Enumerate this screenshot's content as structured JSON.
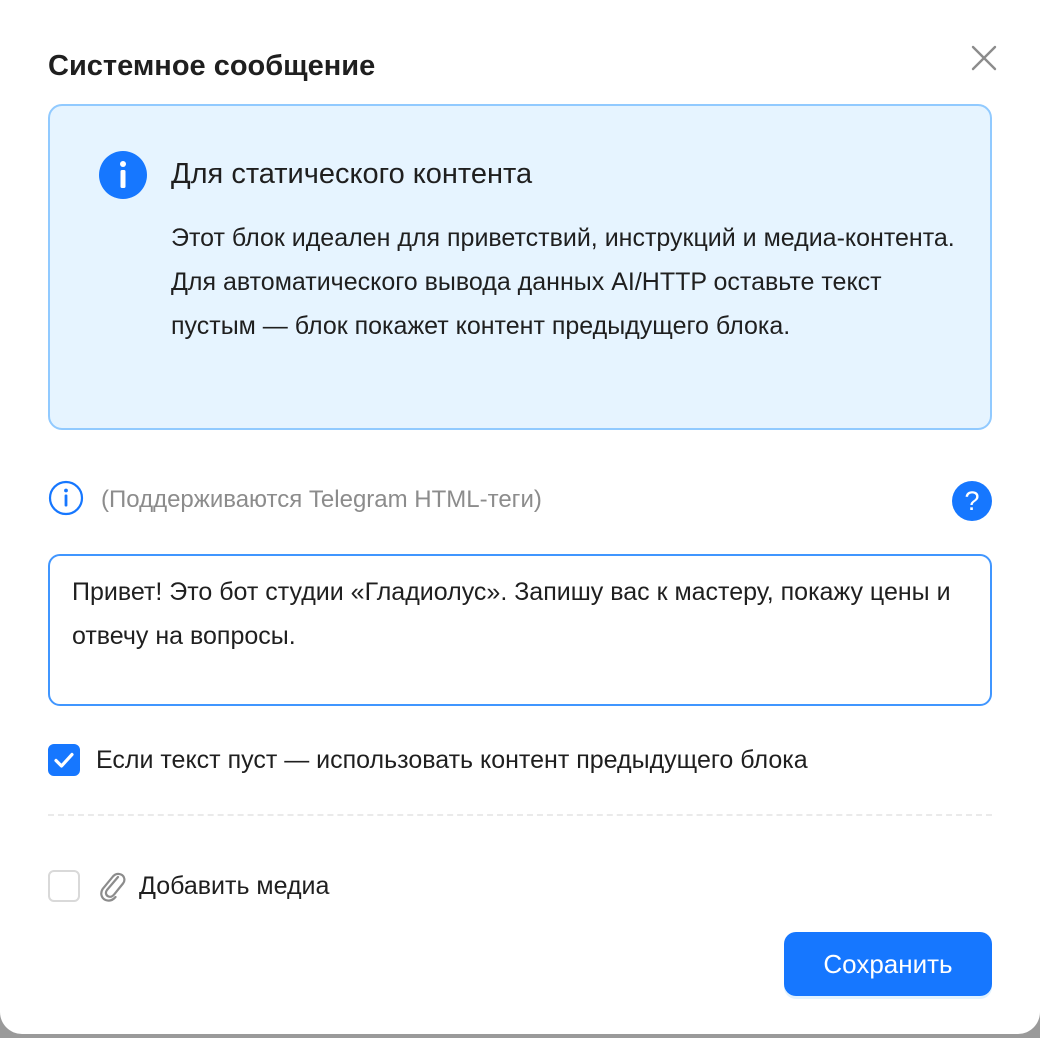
{
  "dialog": {
    "title": "Системное сообщение"
  },
  "info_box": {
    "title": "Для статического контента",
    "description": "Этот блок идеален для приветствий, инструкций и медиа-контента. Для автоматического вывода данных AI/HTTP оставьте текст пустым — блок покажет контент предыдущего блока.",
    "icon": "info-circle-filled-icon",
    "background_color": "#e6f4ff",
    "border_color": "#91caff"
  },
  "hint": {
    "text": "(Поддерживаются Telegram HTML-теги)",
    "icon": "info-circle-outline-icon",
    "help_label": "?"
  },
  "message": {
    "value": "Привет! Это бот студии «Гладиолус». Запишу вас к мастеру, покажу цены и отвечу на вопросы."
  },
  "options": {
    "fallback_label": "Если текст пуст — использовать контент предыдущего блока",
    "fallback_checked": true,
    "media_label": "Добавить медиа",
    "media_checked": false,
    "media_icon": "paperclip-icon"
  },
  "footer": {
    "save_label": "Сохранить"
  },
  "colors": {
    "primary": "#1677ff",
    "text": "#1f1f1f",
    "muted": "#8c8c8c"
  }
}
